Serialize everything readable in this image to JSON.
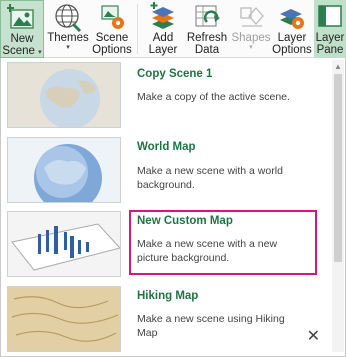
{
  "ribbon": {
    "new_scene": {
      "line1": "New",
      "line2": "Scene",
      "caret": "▾"
    },
    "themes": {
      "line1": "Themes",
      "caret": "▾"
    },
    "scene_options": {
      "line1": "Scene",
      "line2": "Options"
    },
    "add_layer": {
      "line1": "Add",
      "line2": "Layer"
    },
    "refresh_data": {
      "line1": "Refresh",
      "line2": "Data"
    },
    "shapes": {
      "line1": "Shapes",
      "caret": "▾"
    },
    "layer_options": {
      "line1": "Layer",
      "line2": "Options"
    },
    "layer_pane": {
      "line1": "Layer",
      "line2": "Pane"
    }
  },
  "gallery": {
    "items": [
      {
        "title": "Copy Scene 1",
        "desc": "Make a copy of the active scene."
      },
      {
        "title": "World Map",
        "desc": "Make a new scene with a world background."
      },
      {
        "title": "New Custom Map",
        "desc": "Make a new scene with a new picture background."
      },
      {
        "title": "Hiking Map",
        "desc": "Make a new scene using Hiking Map"
      }
    ],
    "close_glyph": "✕",
    "scroll_up_glyph": "▲"
  },
  "colors": {
    "accent": "#217346",
    "highlight": "#d4167f",
    "active": "#c6e2ce"
  }
}
